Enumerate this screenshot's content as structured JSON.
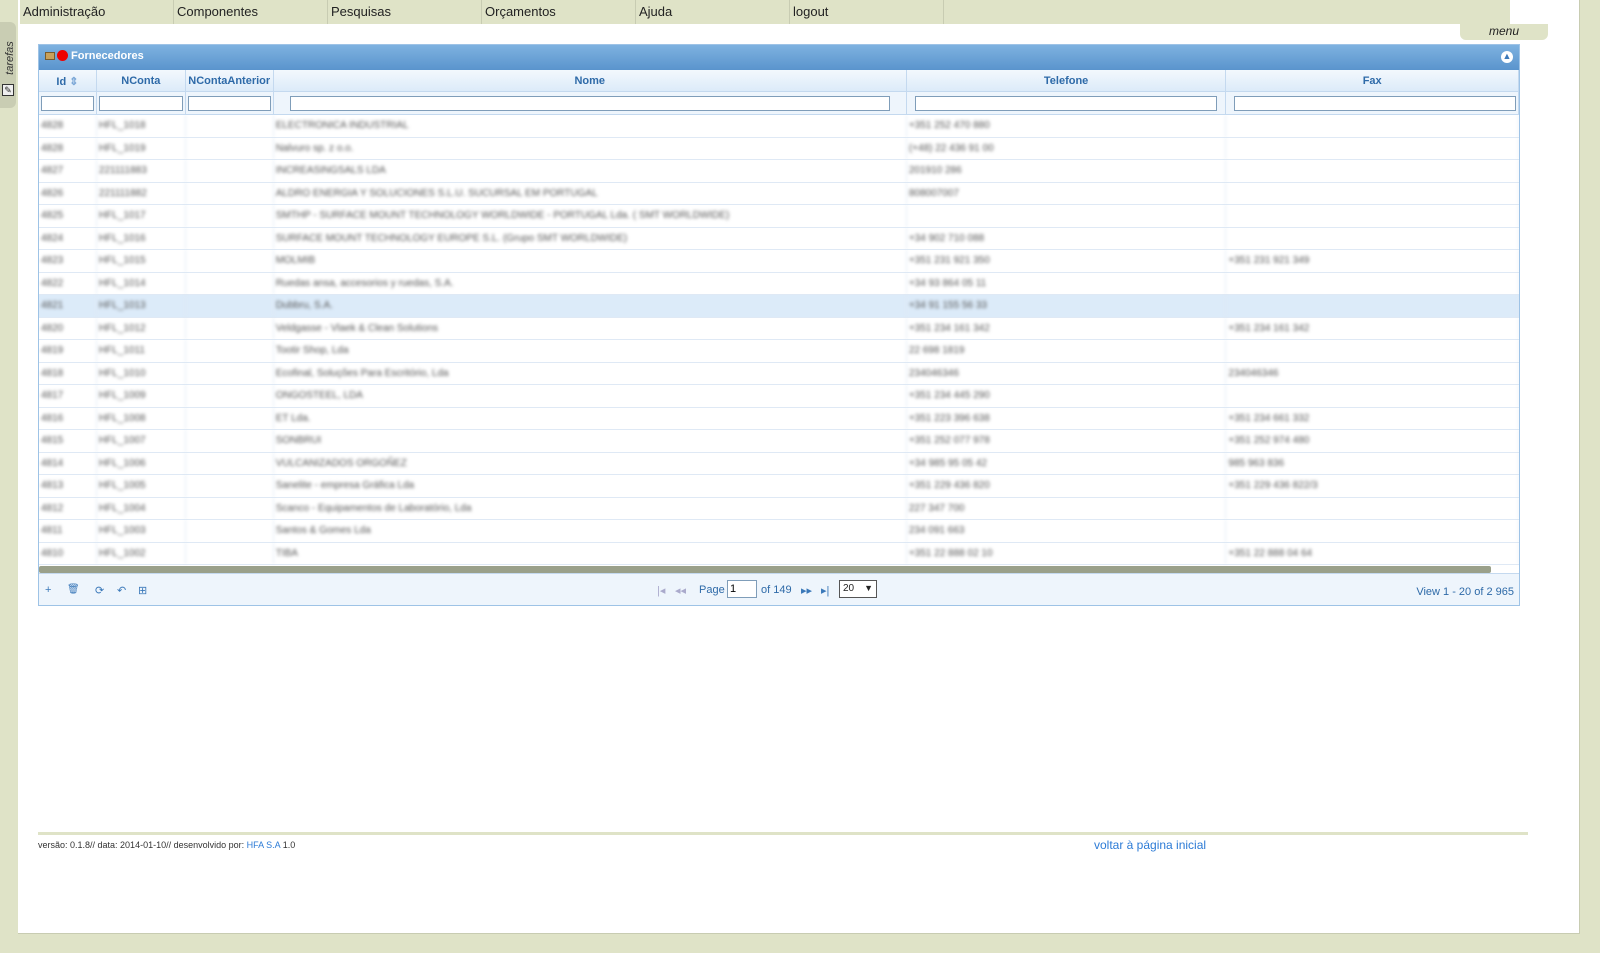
{
  "side": {
    "label": "tarefas",
    "icon": "task-icon"
  },
  "menu": {
    "items": [
      "Administração",
      "Componentes",
      "Pesquisas",
      "Orçamentos",
      "Ajuda",
      "logout"
    ],
    "toggle_label": "menu"
  },
  "grid": {
    "title": "Fornecedores",
    "columns": [
      "Id",
      "NConta",
      "NContaAnterior",
      "Nome",
      "Telefone",
      "Fax"
    ],
    "sort_indicator": "⇕",
    "rows": [
      [
        "4828",
        "HFL_1018",
        "",
        "ELECTRONICA INDUSTRIAL",
        "+351 252 470 880",
        ""
      ],
      [
        "4828",
        "HFL_1019",
        "",
        "Nalvuro sp. z o.o.",
        "(+48) 22 436 91 00",
        ""
      ],
      [
        "4827",
        "221111883",
        "",
        "INCREASINGSALS LDA",
        "201910 286",
        ""
      ],
      [
        "4826",
        "221111882",
        "",
        "ALDRO ENERGIA Y SOLUCIONES S.L.U. SUCURSAL EM PORTUGAL",
        "808007007",
        ""
      ],
      [
        "4825",
        "HFL_1017",
        "",
        "SMTHP - SURFACE MOUNT TECHNOLOGY WORLDWIDE - PORTUGAL Lda. ( SMT WORLDWIDE)",
        "",
        ""
      ],
      [
        "4824",
        "HFL_1016",
        "",
        "SURFACE MOUNT TECHNOLOGY EUROPE S.L. (Grupo SMT WORLDWIDE)",
        "+34 902 710 088",
        ""
      ],
      [
        "4823",
        "HFL_1015",
        "",
        "MOLMIB",
        "+351 231 921 350",
        "+351 231 921 349"
      ],
      [
        "4822",
        "HFL_1014",
        "",
        "Ruedas ansa, accesorios y ruedas, S.A.",
        "+34 93 864 05 11",
        ""
      ],
      [
        "4821",
        "HFL_1013",
        "",
        "Dubbru, S.A.",
        "+34 91 155 56 33",
        ""
      ],
      [
        "4820",
        "HFL_1012",
        "",
        "Veldgasse - Vlaek & Clean Solutions",
        "+351 234 161 342",
        "+351 234 161 342"
      ],
      [
        "4819",
        "HFL_1011",
        "",
        "Tootir Shop, Lda",
        "22 698 1819",
        ""
      ],
      [
        "4818",
        "HFL_1010",
        "",
        "Ecofinal, Soluções Para Escritório, Lda",
        "234046346",
        "234046346"
      ],
      [
        "4817",
        "HFL_1009",
        "",
        "ONGOSTEEL, LDA",
        "+351 234 445 290",
        ""
      ],
      [
        "4816",
        "HFL_1008",
        "",
        "ET Lda.",
        "+351 223 396 638",
        "+351 234 661 332"
      ],
      [
        "4815",
        "HFL_1007",
        "",
        "SONBRUI",
        "+351 252 077 978",
        "+351 252 974 480"
      ],
      [
        "4814",
        "HFL_1006",
        "",
        "VULCANIZADOS ORGOÑEZ",
        "+34 985 95 05 42",
        "985 963 836"
      ],
      [
        "4813",
        "HFL_1005",
        "",
        "Sanelite - empresa Gráfica Lda",
        "+351 229 436 820",
        "+351 229 436 822/3"
      ],
      [
        "4812",
        "HFL_1004",
        "",
        "Scanco - Equipamentos de Laboratório, Lda",
        "227 347 700",
        ""
      ],
      [
        "4811",
        "HFL_1003",
        "",
        "Santos & Gomes Lda",
        "234 091 663",
        ""
      ],
      [
        "4810",
        "HFL_1002",
        "",
        "TIBA",
        "+351 22 888 02 10",
        "+351 22 888 04 64"
      ]
    ],
    "selected_row_index": 8
  },
  "pager": {
    "page_label": "Page",
    "current_page": "1",
    "of_label": "of 149",
    "page_size": "20",
    "view_text": "View 1 - 20 of 2 965",
    "buttons": {
      "add": "+",
      "delete": "🗑",
      "refresh": "⟳",
      "undo": "↶",
      "export": "⊞",
      "first": "|◂",
      "prev": "◂◂",
      "next": "▸▸",
      "last": "▸|",
      "dropdown": "▼"
    }
  },
  "footer": {
    "left_prefix": "versão: 0.1.8// data: 2014-01-10// desenvolvido por:",
    "left_link": "HFA S.A",
    "left_suffix": "1.0",
    "right_link": "voltar à página inicial"
  },
  "colors": {
    "page_bg": "#dfe3c7",
    "header_blue": "#5a94cd",
    "text_blue": "#2e6aa8",
    "selected_row": "#dcebf9"
  }
}
